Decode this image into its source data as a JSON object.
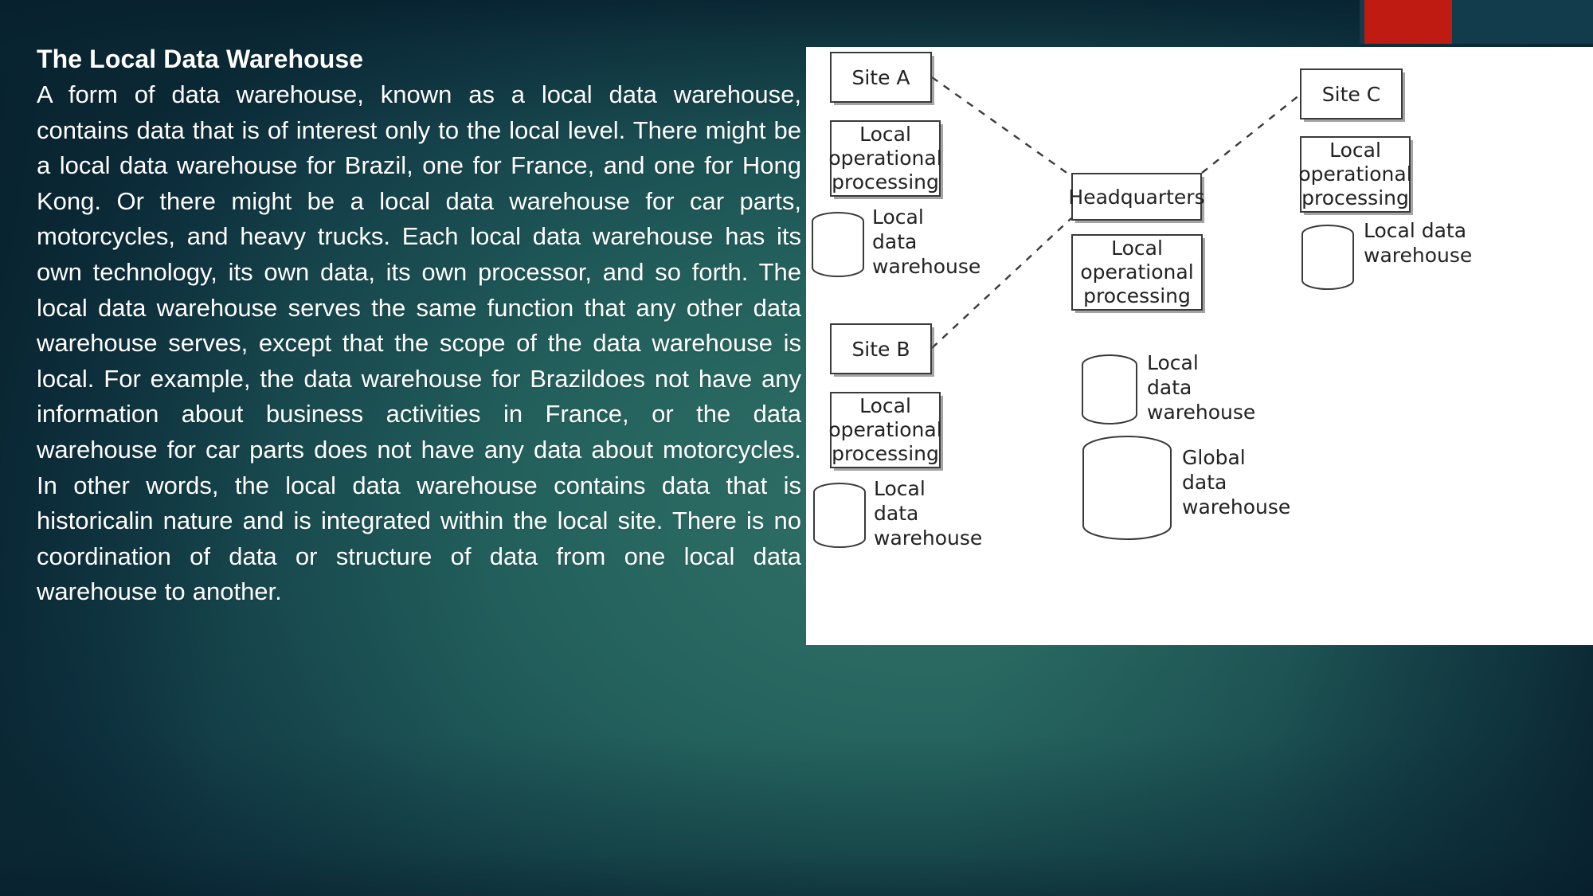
{
  "slide": {
    "title": "The Local Data Warehouse",
    "body": "A form of    data warehouse,    known as   a local   data warehouse,  contains data that   is of  interest  only to the local  level.  There might   be a local   data warehouse for Brazil, one for France, and one for Hong Kong. Or there might   be   a   local   data   warehouse   for   car   parts, motorcycles,   and   heavy   trucks.   Each   local   data warehouse has its own technology, its own data, its own processor,  and so forth.    The local  data warehouse serves  the same function that      any   other   data warehouse serves, except   that  the scope of    the data warehouse is   local.  For  example,  the data warehouse for Brazildoes not have any information about   business activities  in France,   or  the data warehouse for  car  parts does not  have any data about  motorcycles. In other  words, the local  data warehouse contains data that is historicalin nature and is integrated within the local    site. There is no coordination of data or structure of data from one local data warehouse to another."
  },
  "colors": {
    "background_dark": "#0b2935",
    "background_teal": "#2f6f66",
    "accent_red": "#bf1b12",
    "accent_bar_dark": "#123c4b",
    "accent_circle": "#3fb3bd",
    "picture_background": "#ffffff",
    "diagram_line": "#3a3a3a",
    "text": "#ffffff"
  },
  "diagram": {
    "nodes": [
      {
        "id": "site-a",
        "label": "Site A"
      },
      {
        "id": "site-b",
        "label": "Site B"
      },
      {
        "id": "site-c",
        "label": "Site C"
      },
      {
        "id": "headquarters",
        "label": "Headquarters"
      },
      {
        "id": "lop-a",
        "label": "Local operational processing"
      },
      {
        "id": "lop-b",
        "label": "Local operational processing"
      },
      {
        "id": "lop-c",
        "label": "Local operational processing"
      },
      {
        "id": "lop-hq",
        "label": "Local operational processing"
      }
    ],
    "stores": [
      {
        "id": "ldw-a",
        "label": "Local data warehouse"
      },
      {
        "id": "ldw-b",
        "label": "Local data warehouse"
      },
      {
        "id": "ldw-c",
        "label": "Local data warehouse"
      },
      {
        "id": "ldw-hq",
        "label": "Local data warehouse"
      },
      {
        "id": "gdw",
        "label": "Global data warehouse"
      }
    ],
    "links": [
      {
        "from": "site-a",
        "to": "headquarters",
        "style": "dashed"
      },
      {
        "from": "site-b",
        "to": "headquarters",
        "style": "dashed"
      },
      {
        "from": "headquarters",
        "to": "site-c",
        "style": "dashed"
      }
    ]
  }
}
